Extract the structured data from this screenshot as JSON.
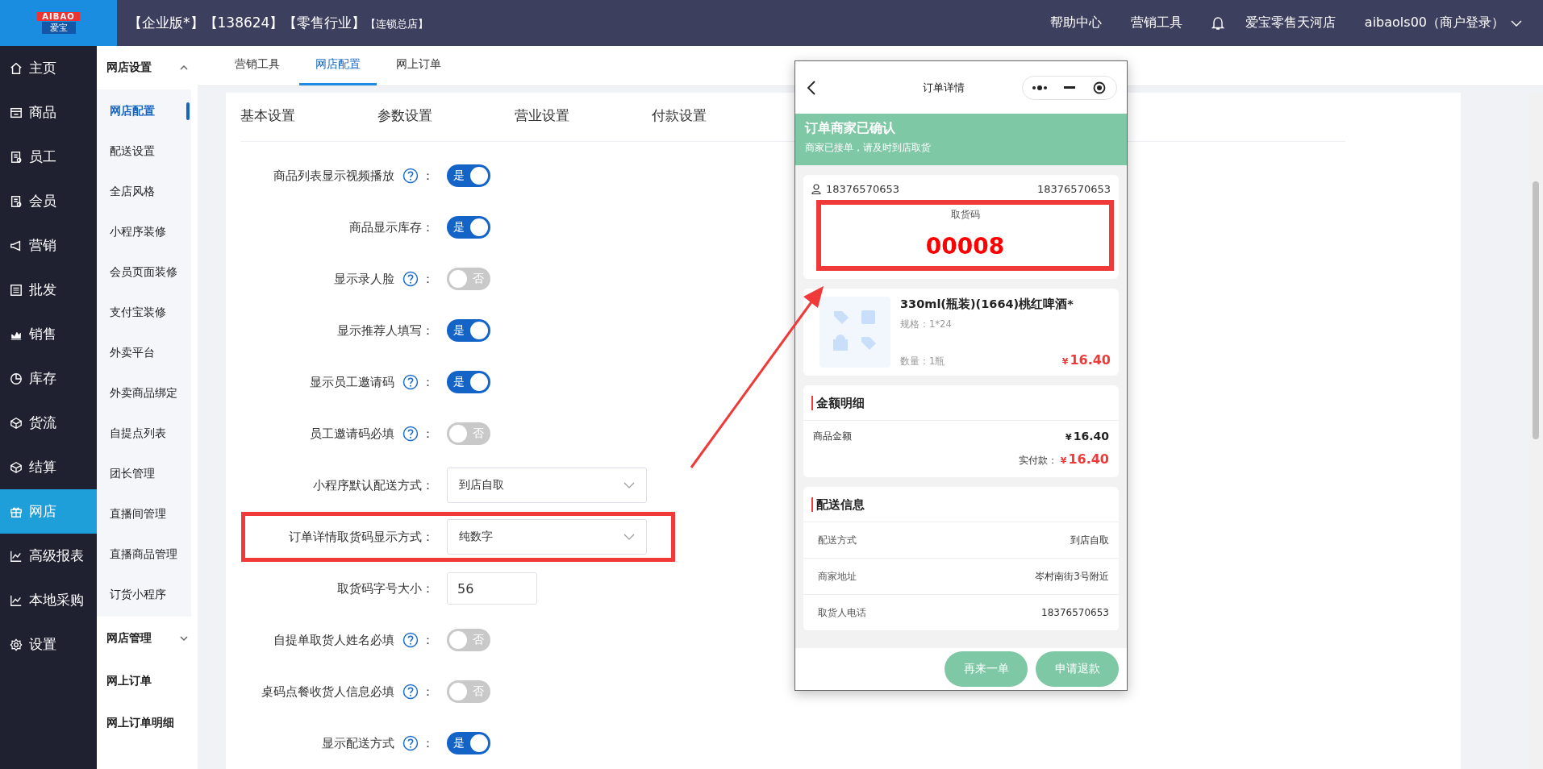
{
  "header": {
    "logo": {
      "top": "AIBAO",
      "bottom": "爱宝"
    },
    "edition": "【企业版*】【138624】【零售行业】",
    "branch": "【连锁总店】",
    "links": [
      "帮助中心",
      "营销工具"
    ],
    "store": "爱宝零售天河店",
    "account": "aibaols00（商户登录）"
  },
  "nav": [
    {
      "label": "主页",
      "selected": false
    },
    {
      "label": "商品",
      "selected": false
    },
    {
      "label": "员工",
      "selected": false
    },
    {
      "label": "会员",
      "selected": false
    },
    {
      "label": "营销",
      "selected": false
    },
    {
      "label": "批发",
      "selected": false
    },
    {
      "label": "销售",
      "selected": false
    },
    {
      "label": "库存",
      "selected": false
    },
    {
      "label": "货流",
      "selected": false
    },
    {
      "label": "结算",
      "selected": false
    },
    {
      "label": "网店",
      "selected": true
    },
    {
      "label": "高级报表",
      "selected": false
    },
    {
      "label": "本地采购",
      "selected": false
    },
    {
      "label": "设置",
      "selected": false
    }
  ],
  "submenu": [
    {
      "title": "网店设置",
      "expanded": true,
      "children": [
        {
          "label": "网店配置",
          "selected": true
        },
        {
          "label": "配送设置",
          "selected": false
        },
        {
          "label": "全店风格",
          "selected": false
        },
        {
          "label": "小程序装修",
          "selected": false
        },
        {
          "label": "会员页面装修",
          "selected": false
        },
        {
          "label": "支付宝装修",
          "selected": false
        },
        {
          "label": "外卖平台",
          "selected": false
        },
        {
          "label": "外卖商品绑定",
          "selected": false
        },
        {
          "label": "自提点列表",
          "selected": false
        },
        {
          "label": "团长管理",
          "selected": false
        },
        {
          "label": "直播间管理",
          "selected": false
        },
        {
          "label": "直播商品管理",
          "selected": false
        },
        {
          "label": "订货小程序",
          "selected": false
        }
      ]
    },
    {
      "title": "网店管理",
      "expanded": false
    }
  ],
  "submenu_links": [
    "网上订单",
    "网上订单明细"
  ],
  "top_tabs": [
    {
      "label": "营销工具",
      "selected": false
    },
    {
      "label": "网店配置",
      "selected": true
    },
    {
      "label": "网上订单",
      "selected": false
    }
  ],
  "settings_tabs": [
    {
      "label": "基本设置",
      "selected": false
    },
    {
      "label": "参数设置",
      "selected": false
    },
    {
      "label": "营业设置",
      "selected": false
    },
    {
      "label": "付款设置",
      "selected": false
    }
  ],
  "form": [
    {
      "label": "商品列表显示视频播放",
      "help": true,
      "suffix": "：",
      "kind": "toggle",
      "on": true,
      "text": "是"
    },
    {
      "label": "商品显示库存",
      "help": false,
      "suffix": "：",
      "kind": "toggle",
      "on": true,
      "text": "是"
    },
    {
      "label": "显示录人脸",
      "help": true,
      "suffix": "：",
      "kind": "toggle",
      "on": false,
      "text": "否"
    },
    {
      "label": "显示推荐人填写",
      "help": false,
      "suffix": "：",
      "kind": "toggle",
      "on": true,
      "text": "是"
    },
    {
      "label": "显示员工邀请码",
      "help": true,
      "suffix": "：",
      "kind": "toggle",
      "on": true,
      "text": "是"
    },
    {
      "label": "员工邀请码必填",
      "help": true,
      "suffix": "：",
      "kind": "toggle",
      "on": false,
      "text": "否"
    },
    {
      "label": "小程序默认配送方式",
      "help": false,
      "suffix": "：",
      "kind": "select",
      "value": "到店自取",
      "highlighted": false
    },
    {
      "label": "订单详情取货码显示方式",
      "help": false,
      "suffix": "：",
      "kind": "select",
      "value": "纯数字",
      "highlighted": true
    },
    {
      "label": "取货码字号大小",
      "help": false,
      "suffix": "：",
      "kind": "input",
      "value": "56"
    },
    {
      "label": "自提单取货人姓名必填",
      "help": true,
      "suffix": "：",
      "kind": "toggle",
      "on": false,
      "text": "否"
    },
    {
      "label": "桌码点餐收货人信息必填",
      "help": true,
      "suffix": "：",
      "kind": "toggle",
      "on": false,
      "text": "否"
    },
    {
      "label": "显示配送方式",
      "help": true,
      "suffix": "：",
      "kind": "toggle",
      "on": true,
      "text": "是"
    }
  ],
  "phone": {
    "title": "订单详情",
    "status": {
      "title": "订单商家已确认",
      "subtitle": "商家已接单，请及时到店取货"
    },
    "contact": {
      "name": "18376570653",
      "phone": "18376570653"
    },
    "pickup": {
      "label": "取货码",
      "code": "00008",
      "highlighted": true
    },
    "product": {
      "name": "330ml(瓶装)(1664)桃红啤酒*",
      "spec": "规格：1*24",
      "qty": "数量：1瓶",
      "currency": "¥",
      "price": "16.40"
    },
    "amount": {
      "title": "金额明细",
      "label": "商品金额",
      "currency": "¥",
      "value": "16.40",
      "paid_label": "实付款：",
      "paid_currency": "¥",
      "paid_value": "16.40"
    },
    "delivery": {
      "title": "配送信息",
      "rows": [
        {
          "label": "配送方式",
          "value": "到店自取"
        },
        {
          "label": "商家地址",
          "value": "岑村南街3号附近"
        },
        {
          "label": "取货人电话",
          "value": "18376570653"
        }
      ]
    },
    "buttons": [
      "再来一单",
      "申请退款"
    ]
  }
}
